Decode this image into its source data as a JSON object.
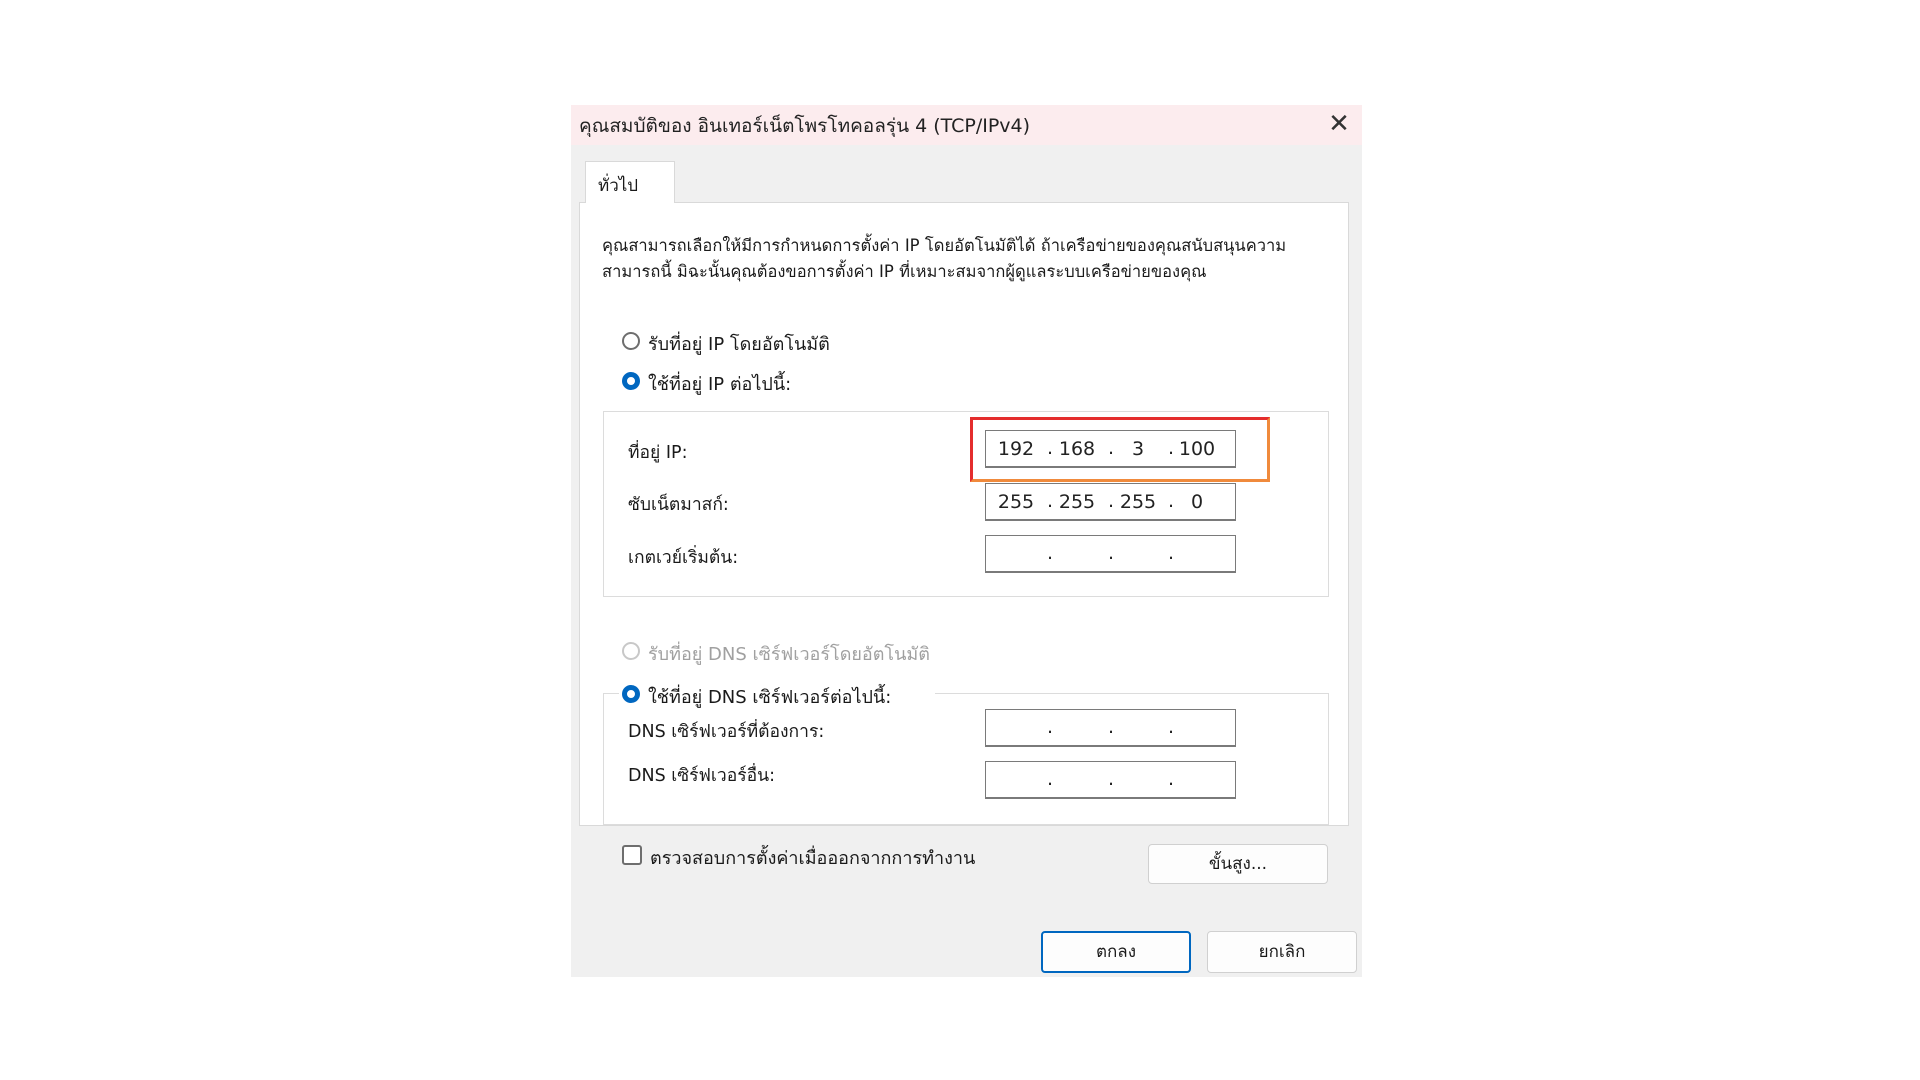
{
  "window": {
    "title": "คุณสมบัติของ อินเทอร์เน็ตโพรโทคอลรุ่น 4 (TCP/IPv4)",
    "close_glyph": "✕"
  },
  "tabs": [
    {
      "label": "ทั่วไป",
      "selected": true
    }
  ],
  "description": "คุณสามารถเลือกให้มีการกำหนดการตั้งค่า IP โดยอัตโนมัติได้ ถ้าเครือข่ายของคุณสนับสนุนความสามารถนี้ มิฉะนั้นคุณต้องขอการตั้งค่า IP ที่เหมาะสมจากผู้ดูแลระบบเครือข่ายของคุณ",
  "ip_mode": {
    "auto_label": "รับที่อยู่ IP โดยอัตโนมัติ",
    "manual_label": "ใช้ที่อยู่ IP ต่อไปนี้:",
    "selected": "manual"
  },
  "ip_fields": {
    "address": {
      "label": "ที่อยู่ IP:",
      "octets": [
        "192",
        "168",
        "3",
        "100"
      ]
    },
    "subnet": {
      "label": "ซับเน็ตมาสก์:",
      "octets": [
        "255",
        "255",
        "255",
        "0"
      ]
    },
    "gateway": {
      "label": "เกตเวย์เริ่มต้น:",
      "octets": [
        "",
        "",
        "",
        ""
      ]
    }
  },
  "dns_mode": {
    "auto_label": "รับที่อยู่ DNS เซิร์ฟเวอร์โดยอัตโนมัติ",
    "manual_label": "ใช้ที่อยู่ DNS เซิร์ฟเวอร์ต่อไปนี้:",
    "selected": "manual",
    "auto_disabled": true
  },
  "dns_fields": {
    "preferred": {
      "label": "DNS เซิร์ฟเวอร์ที่ต้องการ:",
      "octets": [
        "",
        "",
        "",
        ""
      ]
    },
    "alternate": {
      "label": "DNS เซิร์ฟเวอร์อื่น:",
      "octets": [
        "",
        "",
        "",
        ""
      ]
    }
  },
  "validate_on_exit": {
    "label": "ตรวจสอบการตั้งค่าเมื่อออกจากการทำงาน",
    "checked": false
  },
  "buttons": {
    "advanced": "ขั้นสูง...",
    "ok": "ตกลง",
    "cancel": "ยกเลิก"
  },
  "colors": {
    "accent": "#0067c0",
    "highlight_frame": "#f08a3c",
    "titlebar": "#fcecee"
  }
}
